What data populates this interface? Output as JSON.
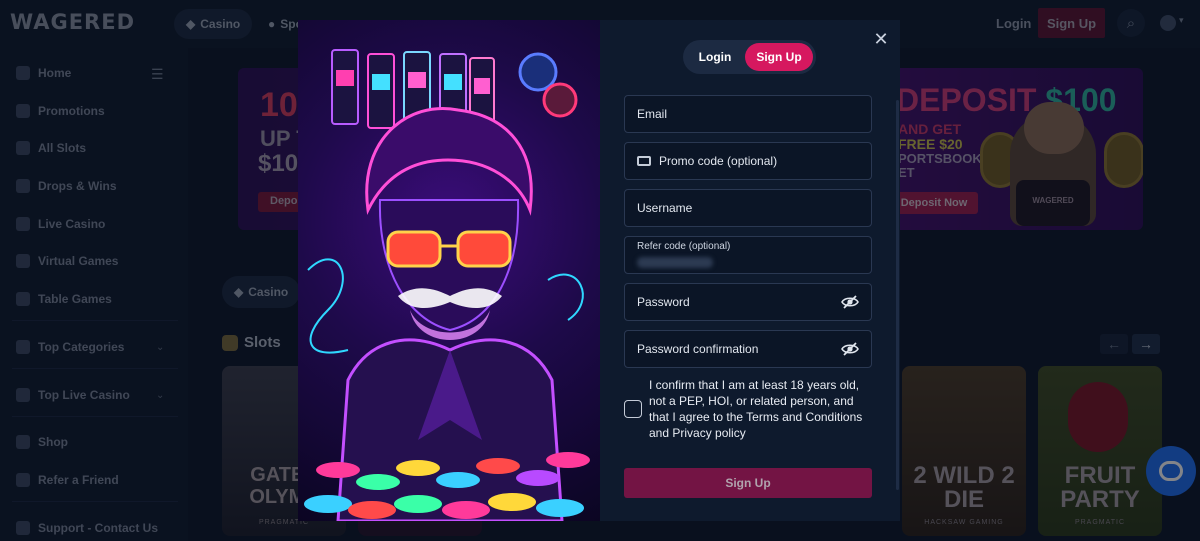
{
  "site": {
    "logo": "WAGERED",
    "top_tabs": [
      {
        "label": "Casino"
      },
      {
        "label": "Spo"
      }
    ],
    "top_login": "Login",
    "top_signup": "Sign Up"
  },
  "sidebar": {
    "items": [
      {
        "label": "Home"
      },
      {
        "label": "Promotions"
      },
      {
        "label": "All Slots"
      },
      {
        "label": "Drops & Wins"
      },
      {
        "label": "Live Casino"
      },
      {
        "label": "Virtual Games"
      },
      {
        "label": "Table Games"
      },
      {
        "label": "Top Categories"
      },
      {
        "label": "Top Live Casino"
      },
      {
        "label": "Shop"
      },
      {
        "label": "Refer a Friend"
      },
      {
        "label": "Support - Contact Us"
      }
    ]
  },
  "banner": {
    "left_big": "10",
    "left_up": "UP T",
    "left_amount": "$10",
    "left_button": "Depo",
    "deposit_prefix": "DEPOSIT",
    "deposit_amount": "$100",
    "and_get": "AND GET",
    "free_amount": "FREE $20",
    "sportsbook": "PORTSBOOK",
    "bet": "ET",
    "button": "Deposit Now",
    "shirt_text": "WAGERED"
  },
  "lobby": {
    "pill_casino": "Casino",
    "slots_title": "Slots",
    "cards": [
      {
        "title": "GATES OLYMP",
        "studio": "PRAGMATIC"
      },
      {
        "title": "2 WILD 2 DIE",
        "studio": "HACKSAW GAMING"
      },
      {
        "title": "FRUIT PARTY",
        "studio": "PRAGMATIC"
      }
    ]
  },
  "modal": {
    "tabs": {
      "login": "Login",
      "signup": "Sign Up"
    },
    "fields": {
      "email": {
        "placeholder": "Email"
      },
      "promo": {
        "placeholder": "Promo code (optional)"
      },
      "username": {
        "placeholder": "Username"
      },
      "refer": {
        "label": "Refer code (optional)"
      },
      "password": {
        "placeholder": "Password"
      },
      "password_confirm": {
        "placeholder": "Password confirmation"
      }
    },
    "consent": "I confirm that I am at least 18 years old, not a PEP, HOI, or related person, and that I agree to the Terms and Conditions and Privacy policy",
    "submit": "Sign Up"
  },
  "colors": {
    "accent": "#d6185f",
    "submit_disabled": "#731444",
    "modal_bg": "#0e1a2d",
    "chat": "#1e6ef0"
  },
  "icons": [
    "close-icon",
    "ticket-icon",
    "eye-slash-icon",
    "search-icon",
    "chat-icon",
    "casino-icon"
  ]
}
